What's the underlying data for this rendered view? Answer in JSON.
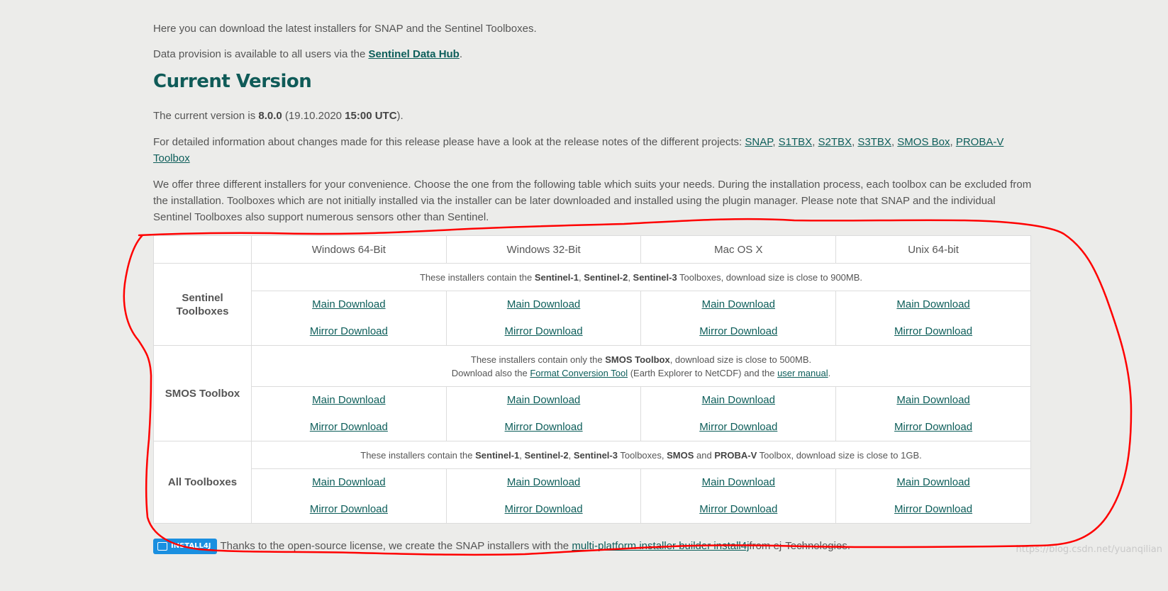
{
  "intro": {
    "line1": "Here you can download the latest installers for SNAP and the Sentinel Toolboxes.",
    "line2_prefix": "Data provision is available to all users via the ",
    "line2_link": "Sentinel Data Hub",
    "line2_suffix": "."
  },
  "heading": "Current Version",
  "version": {
    "prefix": "The current version is ",
    "number": "8.0.0",
    "mid": " (19.10.2020 ",
    "time": "15:00 UTC",
    "suffix": ")."
  },
  "notes": {
    "prefix": "For detailed information about changes made for this release please have a look at the release notes of the different projects: ",
    "links": [
      "SNAP",
      "S1TBX",
      "S2TBX",
      "S3TBX",
      "SMOS Box",
      "PROBA-V Toolbox"
    ],
    "sep": ", "
  },
  "offer": "We offer three different installers for your convenience. Choose the one from the following table which suits your needs. During the installation process, each toolbox can be excluded from the installation. Toolboxes which are not initially installed via the installer can be later downloaded and installed using the plugin manager. Please note that SNAP and the individual Sentinel Toolboxes also support numerous sensors other than Sentinel.",
  "table": {
    "columns": [
      "Windows 64-Bit",
      "Windows 32-Bit",
      "Mac OS X",
      "Unix 64-bit"
    ],
    "main_label": "Main Download",
    "mirror_label": "Mirror Download",
    "sentinel": {
      "title_line1": "Sentinel",
      "title_line2": "Toolboxes",
      "info_a": "These installers contain the ",
      "info_b": "Sentinel-1",
      "info_c": ", ",
      "info_d": "Sentinel-2",
      "info_e": ", ",
      "info_f": "Sentinel-3",
      "info_g": " Toolboxes, download size is close to 900MB."
    },
    "smos": {
      "title": "SMOS Toolbox",
      "info1_a": "These installers contain only the ",
      "info1_b": "SMOS Toolbox",
      "info1_c": ", download size is close to 500MB.",
      "info2_a": "Download also the ",
      "info2_link1": "Format Conversion Tool",
      "info2_b": " (Earth Explorer to NetCDF) and the ",
      "info2_link2": "user manual",
      "info2_c": "."
    },
    "all": {
      "title": "All Toolboxes",
      "info_a": "These installers contain the ",
      "info_b": "Sentinel-1",
      "info_c": ", ",
      "info_d": "Sentinel-2",
      "info_e": ", ",
      "info_f": "Sentinel-3",
      "info_g": " Toolboxes, ",
      "info_h": "SMOS",
      "info_i": " and ",
      "info_j": "PROBA-V",
      "info_k": " Toolbox, download size is close to 1GB."
    }
  },
  "footer": {
    "badge": "INSTALL4J",
    "prefix": " Thanks to the open-source license, we create the SNAP installers with the ",
    "link": "multi-platform installer builder install4j",
    "suffix": " from ej-Technologies."
  },
  "watermark": "https://blog.csdn.net/yuanqilian",
  "colors": {
    "background": "#ececea",
    "link": "#0d5e5a",
    "heading": "#0f5b58",
    "annotation": "#ff0000",
    "badge": "#1a8fe0"
  }
}
